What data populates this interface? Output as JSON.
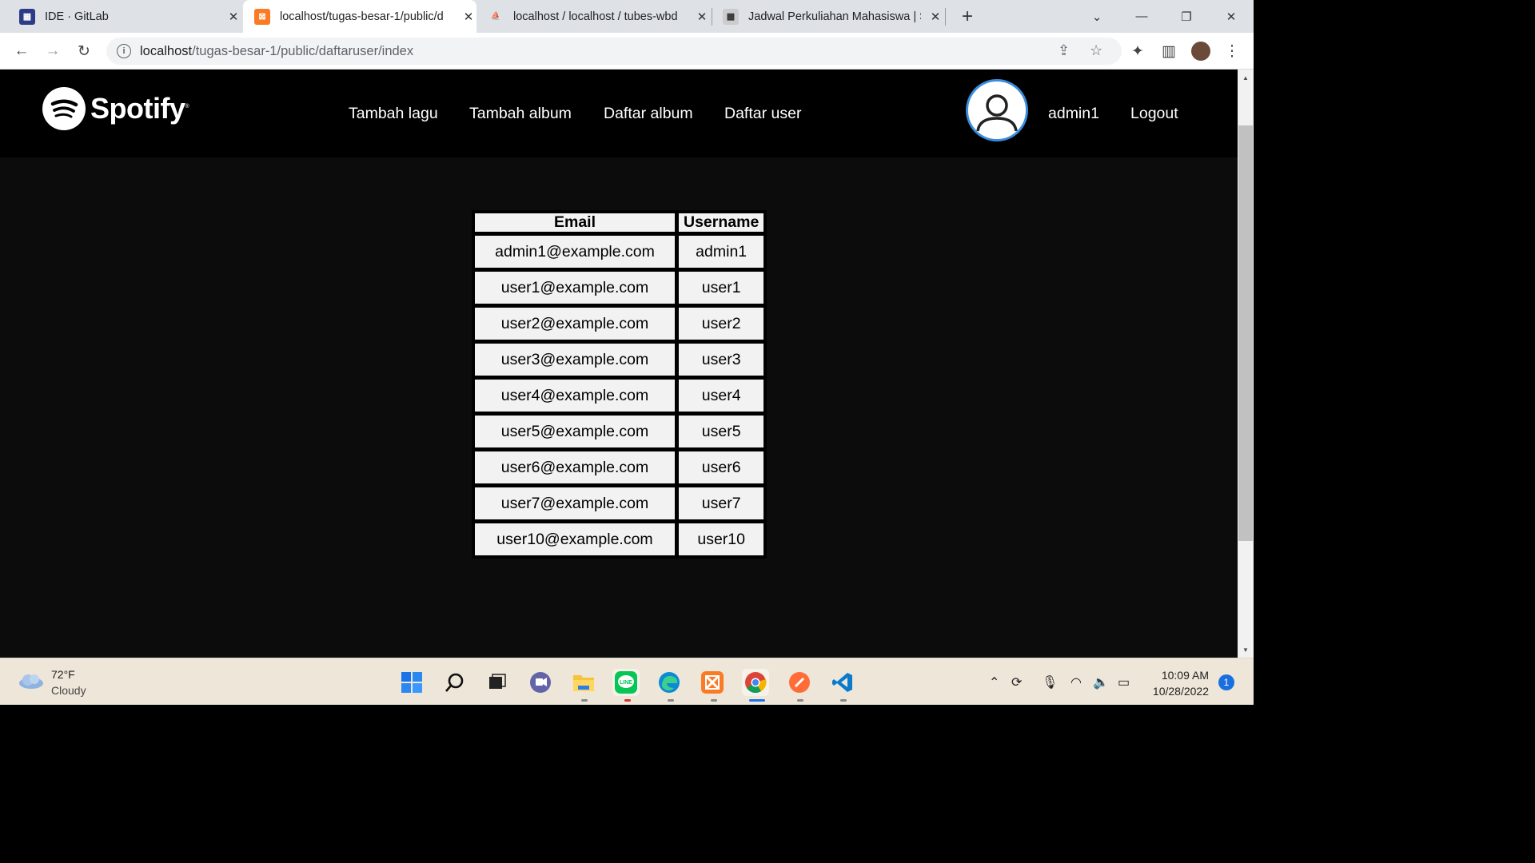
{
  "browser": {
    "tabs": [
      {
        "title": "IDE · GitLab",
        "icon": "gitlab-ide-icon",
        "active": false
      },
      {
        "title": "localhost/tugas-besar-1/public/d",
        "icon": "xampp-icon",
        "active": true
      },
      {
        "title": "localhost / localhost / tubes-wbd",
        "icon": "phpmyadmin-icon",
        "active": false
      },
      {
        "title": "Jadwal Perkuliahan Mahasiswa | S",
        "icon": "campus-icon",
        "active": false
      }
    ],
    "new_tab_symbol": "+",
    "url_host": "localhost",
    "url_path": "/tugas-besar-1/public/daftaruser/index"
  },
  "header": {
    "logo_text": "Spotify",
    "nav": [
      "Tambah lagu",
      "Tambah album",
      "Daftar album",
      "Daftar user"
    ],
    "username": "admin1",
    "logout": "Logout"
  },
  "table": {
    "columns": [
      "Email",
      "Username"
    ],
    "rows": [
      [
        "admin1@example.com",
        "admin1"
      ],
      [
        "user1@example.com",
        "user1"
      ],
      [
        "user2@example.com",
        "user2"
      ],
      [
        "user3@example.com",
        "user3"
      ],
      [
        "user4@example.com",
        "user4"
      ],
      [
        "user5@example.com",
        "user5"
      ],
      [
        "user6@example.com",
        "user6"
      ],
      [
        "user7@example.com",
        "user7"
      ],
      [
        "user10@example.com",
        "user10"
      ]
    ]
  },
  "taskbar": {
    "weather_temp": "72°F",
    "weather_desc": "Cloudy",
    "time": "10:09 AM",
    "date": "10/28/2022",
    "notification_count": "1"
  },
  "colors": {
    "accent": "#3a8dde",
    "header_bg": "#000000",
    "page_bg": "#0c0c0c",
    "cell_bg": "#f2f2f2"
  }
}
